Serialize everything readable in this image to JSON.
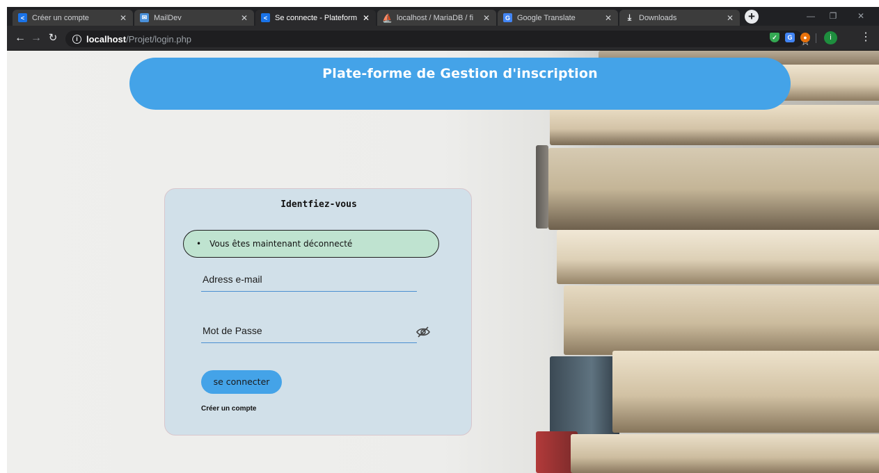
{
  "browser": {
    "tabs": [
      {
        "title": "Créer un compte",
        "favicon": "code-icon",
        "active": false
      },
      {
        "title": "MailDev",
        "favicon": "mail-icon",
        "active": false
      },
      {
        "title": "Se connecte - Plateform",
        "favicon": "code-icon",
        "active": true
      },
      {
        "title": "localhost / MariaDB / fi",
        "favicon": "phpmyadmin-icon",
        "active": false
      },
      {
        "title": "Google Translate",
        "favicon": "translate-icon",
        "active": false
      },
      {
        "title": "Downloads",
        "favicon": "download-icon",
        "active": false
      }
    ],
    "address": {
      "host": "localhost",
      "path": "/Projet/login.php"
    },
    "profile_initial": "i"
  },
  "page": {
    "header_title": "Plate-forme de Gestion d'inscription",
    "login": {
      "heading": "Identfiez-vous",
      "flash_message": "Vous êtes maintenant déconnecté",
      "email_label": "Adress e-mail",
      "password_label": "Mot de Passe",
      "submit_label": "se connecter",
      "create_account_link": "Créer un compte"
    }
  },
  "colors": {
    "banner": "#44a3e8",
    "flash_background": "#bfe3d0",
    "field_underline": "#4a8fd1",
    "browser_chrome": "#202124"
  }
}
